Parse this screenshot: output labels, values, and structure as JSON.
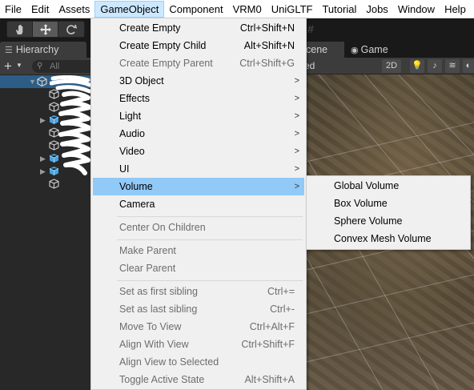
{
  "menubar": {
    "items": [
      "File",
      "Edit",
      "Assets",
      "GameObject",
      "Component",
      "VRM0",
      "UniGLTF",
      "Tutorial",
      "Jobs",
      "Window",
      "Help"
    ],
    "active": "GameObject"
  },
  "toolbar": {
    "tools": [
      "hand-tool-icon",
      "move-tool-icon",
      "rotate-tool-icon"
    ],
    "active_tool": "move-tool-icon"
  },
  "hierarchy": {
    "tab_label": "Hierarchy",
    "add_label": "+",
    "search_placeholder": "All"
  },
  "scene": {
    "scene_tab_label": "cene",
    "game_tab_label": "Game",
    "shading_mode": "ed",
    "mode_2d": "2D"
  },
  "menu": {
    "create_empty": {
      "label": "Create Empty",
      "shortcut": "Ctrl+Shift+N"
    },
    "create_empty_child": {
      "label": "Create Empty Child",
      "shortcut": "Alt+Shift+N"
    },
    "create_empty_parent": {
      "label": "Create Empty Parent",
      "shortcut": "Ctrl+Shift+G"
    },
    "object_3d": {
      "label": "3D Object"
    },
    "effects": {
      "label": "Effects"
    },
    "light": {
      "label": "Light"
    },
    "audio": {
      "label": "Audio"
    },
    "video": {
      "label": "Video"
    },
    "ui": {
      "label": "UI"
    },
    "volume": {
      "label": "Volume"
    },
    "camera": {
      "label": "Camera"
    },
    "center_on_children": {
      "label": "Center On Children"
    },
    "make_parent": {
      "label": "Make Parent"
    },
    "clear_parent": {
      "label": "Clear Parent"
    },
    "set_first_sibling": {
      "label": "Set as first sibling",
      "shortcut": "Ctrl+="
    },
    "set_last_sibling": {
      "label": "Set as last sibling",
      "shortcut": "Ctrl+-"
    },
    "move_to_view": {
      "label": "Move To View",
      "shortcut": "Ctrl+Alt+F"
    },
    "align_with_view": {
      "label": "Align With View",
      "shortcut": "Ctrl+Shift+F"
    },
    "align_view_to_selected": {
      "label": "Align View to Selected"
    },
    "toggle_active_state": {
      "label": "Toggle Active State",
      "shortcut": "Alt+Shift+A"
    }
  },
  "submenu": {
    "global_volume": "Global Volume",
    "box_volume": "Box Volume",
    "sphere_volume": "Sphere Volume",
    "convex_mesh_volume": "Convex Mesh Volume"
  },
  "colors": {
    "menu_bg": "#f0f0f0",
    "highlight": "#91c9f7",
    "active_menubar": "#cce8ff",
    "editor_dark": "#282828"
  }
}
